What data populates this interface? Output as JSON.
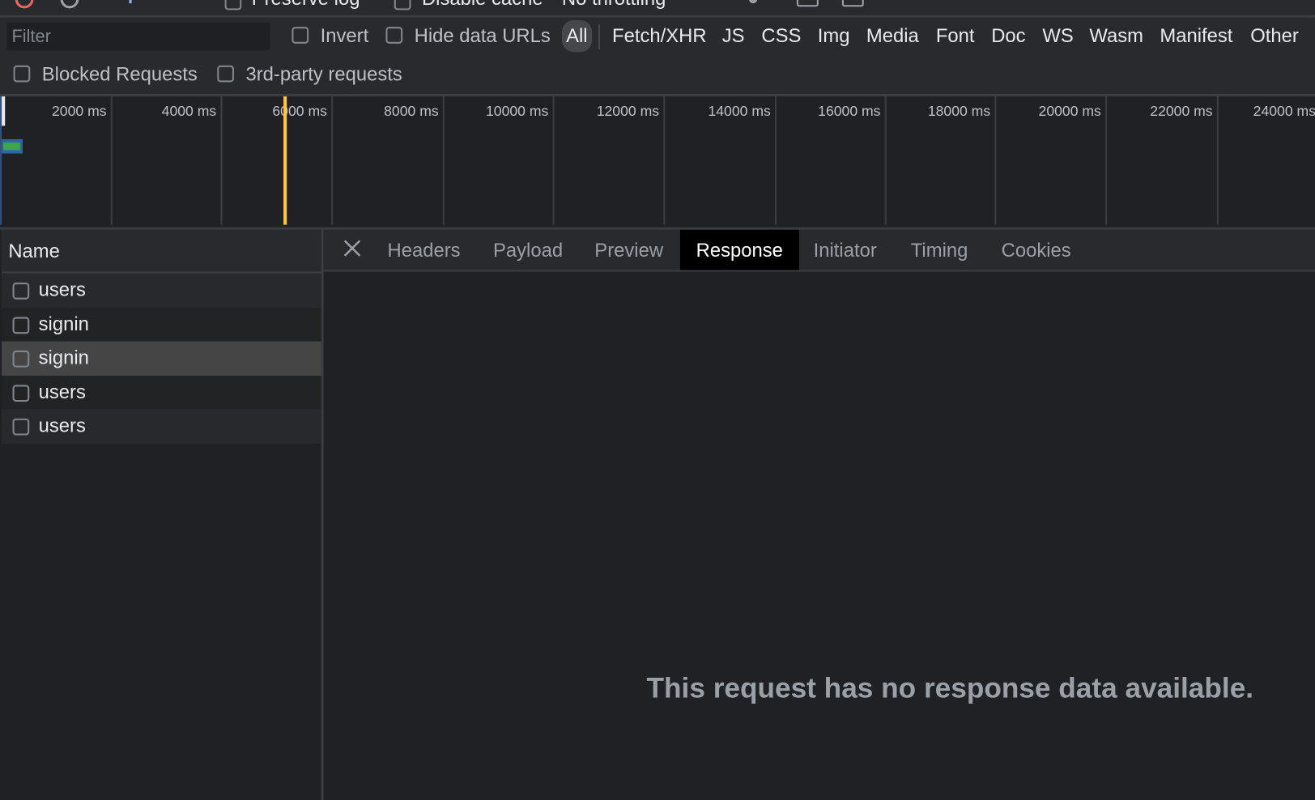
{
  "toolbar": {
    "preserve_log": "Preserve log",
    "disable_cache": "Disable cache",
    "throttling": "No throttling"
  },
  "filter": {
    "placeholder": "Filter",
    "invert": "Invert",
    "hide_data_urls": "Hide data URLs",
    "types": [
      "All",
      "Fetch/XHR",
      "JS",
      "CSS",
      "Img",
      "Media",
      "Font",
      "Doc",
      "WS",
      "Wasm",
      "Manifest",
      "Other"
    ],
    "active_type": "All",
    "blocked_requests": "Blocked Requests",
    "third_party": "3rd-party requests"
  },
  "timeline": {
    "ticks": [
      "2000 ms",
      "4000 ms",
      "6000 ms",
      "8000 ms",
      "10000 ms",
      "12000 ms",
      "14000 ms",
      "16000 ms",
      "18000 ms",
      "20000 ms",
      "22000 ms",
      "24000 ms"
    ],
    "marker_color": "#f9c846"
  },
  "requests": {
    "header": "Name",
    "rows": [
      {
        "name": "users"
      },
      {
        "name": "signin"
      },
      {
        "name": "signin",
        "selected": true
      },
      {
        "name": "users"
      },
      {
        "name": "users"
      }
    ]
  },
  "details": {
    "tabs": [
      "Headers",
      "Payload",
      "Preview",
      "Response",
      "Initiator",
      "Timing",
      "Cookies"
    ],
    "active_tab": "Response",
    "message": "This request has no response data available."
  }
}
